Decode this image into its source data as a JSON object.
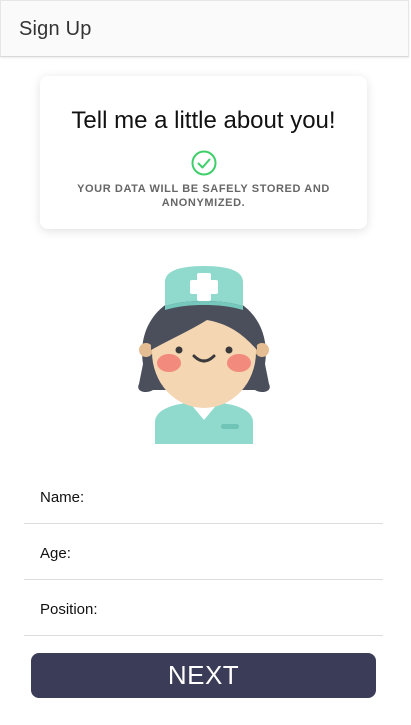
{
  "header": {
    "title": "Sign Up"
  },
  "intro_card": {
    "title": "Tell me a little about you!",
    "icon": "check-circle-icon",
    "subtitle": "YOUR DATA WILL BE SAFELY STORED AND ANONYMIZED."
  },
  "avatar": {
    "icon": "nurse-avatar-icon"
  },
  "form": {
    "fields": [
      {
        "label": "Name:",
        "value": ""
      },
      {
        "label": "Age:",
        "value": ""
      },
      {
        "label": "Position:",
        "value": ""
      }
    ]
  },
  "actions": {
    "next_label": "NEXT"
  },
  "colors": {
    "accent_green": "#3ecf6a",
    "button_bg": "#3b3d58",
    "nurse_teal": "#8fd9cd"
  }
}
